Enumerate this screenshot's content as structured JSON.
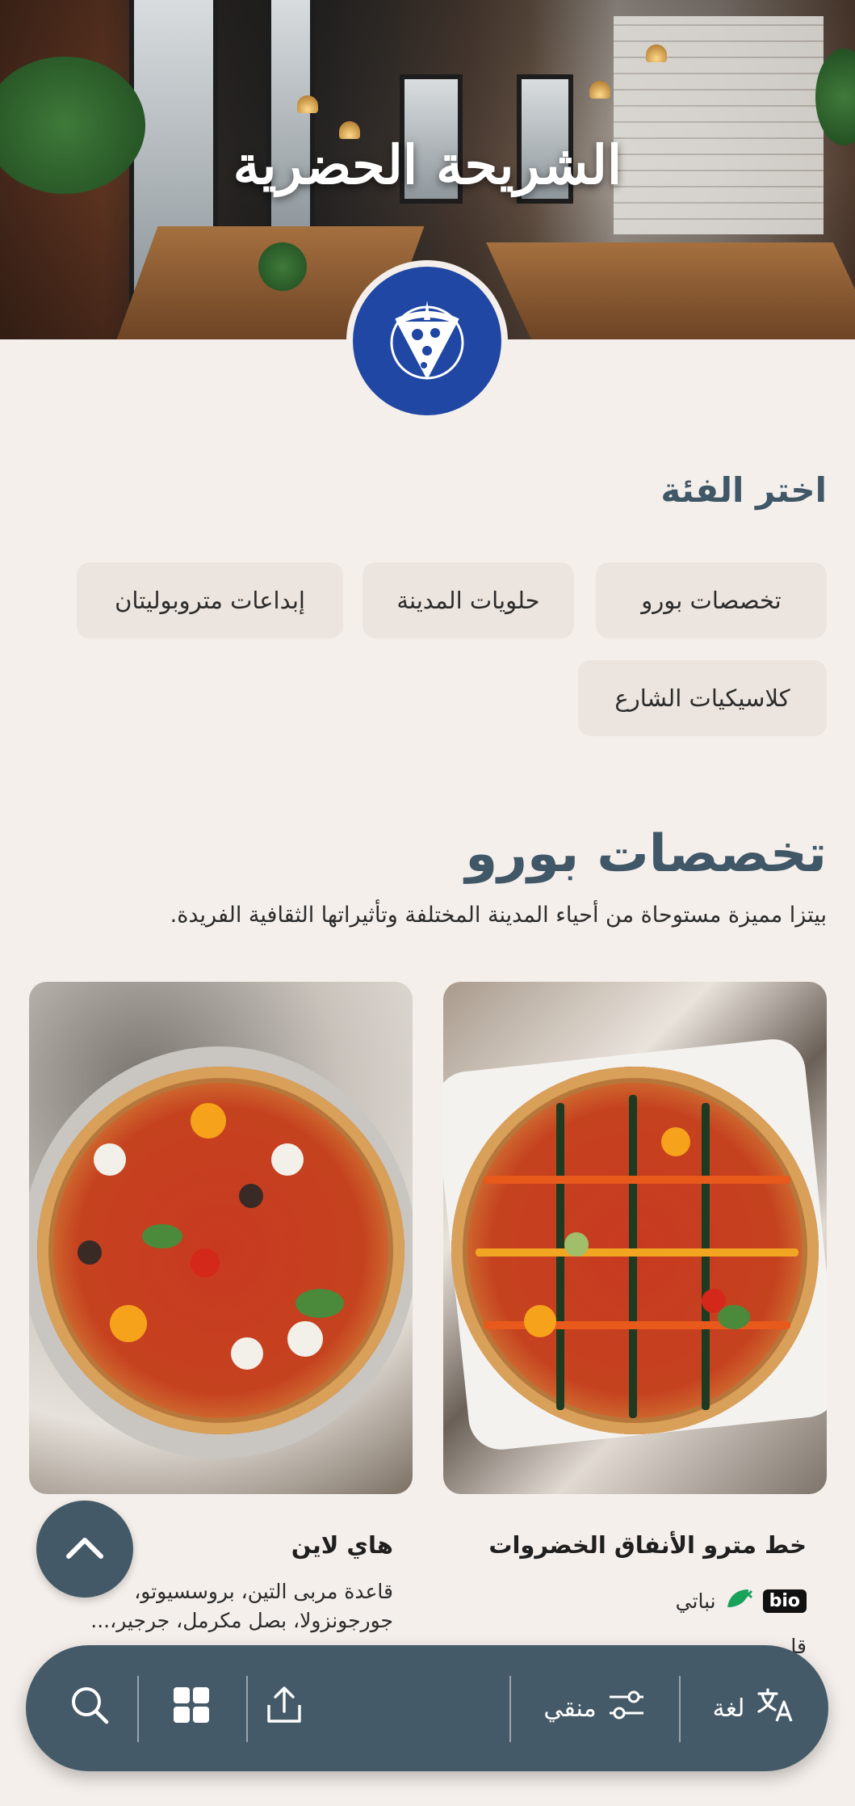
{
  "hero": {
    "title": "الشريحة الحضرية",
    "logo_icon": "pizza-slice-logo-icon",
    "logo_color": "#1f47a3"
  },
  "categories": {
    "heading": "اختر الفئة",
    "items": [
      {
        "label": "تخصصات بورو",
        "selected": true
      },
      {
        "label": "حلويات المدينة"
      },
      {
        "label": "إبداعات متروبوليتان"
      },
      {
        "label": "كلاسيكيات الشارع"
      }
    ]
  },
  "section": {
    "title": "تخصصات بورو",
    "description": "بيتزا مميزة مستوحاة من أحياء المدينة المختلفة وتأثيراتها الثقافية الفريدة."
  },
  "products": [
    {
      "name": "خط مترو الأنفاق الخضروات",
      "badge": "bio",
      "tag": "نباتي",
      "tag_icon": "vegan-leaf-icon",
      "tag_color": "#19a35a",
      "description": "قا"
    },
    {
      "name": "هاي لاين",
      "description": "قاعدة مربى التين، بروسسيوتو، جورجونزولا، بصل مكرمل، جرجير،..."
    }
  ],
  "scroll_top": {
    "icon": "chevron-up-icon"
  },
  "bottom_bar": {
    "language_label": "لغة",
    "language_icon": "translate-icon",
    "filter_label": "منقي",
    "filter_icon": "filter-sliders-icon",
    "share_icon": "share-upload-icon",
    "grid_icon": "grid-icon",
    "search_icon": "search-icon",
    "bar_color": "#455a68"
  },
  "colors": {
    "background": "#f5efeb",
    "heading": "#3f5767",
    "chip": "#ece4de"
  }
}
